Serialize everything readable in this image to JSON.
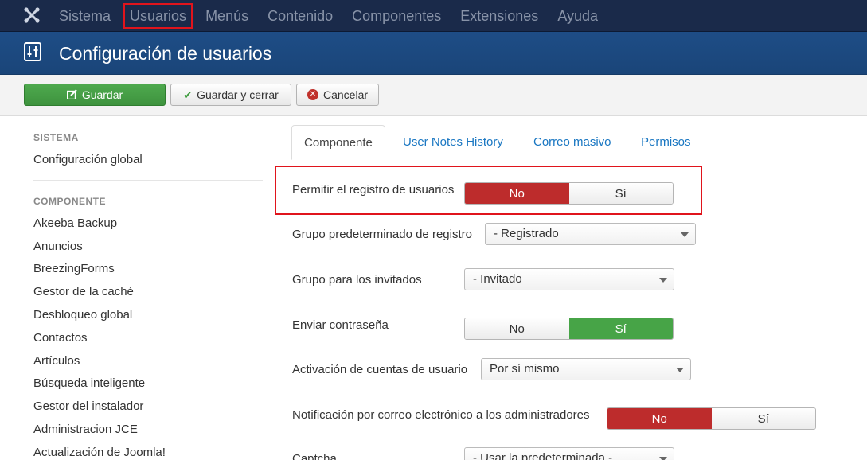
{
  "topnav": {
    "logo_icon": "joomla-logo-icon",
    "items": [
      {
        "label": "Sistema"
      },
      {
        "label": "Usuarios"
      },
      {
        "label": "Menús"
      },
      {
        "label": "Contenido"
      },
      {
        "label": "Componentes"
      },
      {
        "label": "Extensiones"
      },
      {
        "label": "Ayuda"
      }
    ],
    "active": "Usuarios"
  },
  "titlebar": {
    "title": "Configuración de usuarios",
    "icon": "equalizer-icon"
  },
  "toolbar": {
    "save_label": "Guardar",
    "save_close_label": "Guardar y cerrar",
    "cancel_label": "Cancelar",
    "save_color": "#46a546",
    "cancel_icon_color": "#c0322c"
  },
  "sidebar": {
    "system_heading": "SISTEMA",
    "global_config": "Configuración global",
    "component_heading": "COMPONENTE",
    "items": [
      {
        "label": "Akeeba Backup"
      },
      {
        "label": "Anuncios"
      },
      {
        "label": "BreezingForms"
      },
      {
        "label": "Gestor de la caché"
      },
      {
        "label": "Desbloqueo global"
      },
      {
        "label": "Contactos"
      },
      {
        "label": "Artículos"
      },
      {
        "label": "Búsqueda inteligente"
      },
      {
        "label": "Gestor del instalador"
      },
      {
        "label": "Administracion JCE"
      },
      {
        "label": "Actualización de Joomla!"
      }
    ]
  },
  "tabs": [
    {
      "label": "Componente",
      "active": true
    },
    {
      "label": "User Notes History"
    },
    {
      "label": "Correo masivo"
    },
    {
      "label": "Permisos"
    }
  ],
  "form": {
    "allow_registration": {
      "label": "Permitir el registro de usuarios",
      "no": "No",
      "yes": "Sí",
      "value": "No"
    },
    "default_group": {
      "label": "Grupo predeterminado de registro",
      "value": "- Registrado"
    },
    "guest_group": {
      "label": "Grupo para los invitados",
      "value": "- Invitado"
    },
    "send_password": {
      "label": "Enviar contraseña",
      "no": "No",
      "yes": "Sí",
      "value": "Sí"
    },
    "activation": {
      "label": "Activación de cuentas de usuario",
      "value": "Por sí mismo"
    },
    "admin_notify": {
      "label": "Notificación por correo electrónico a los administradores",
      "no": "No",
      "yes": "Sí",
      "value": "No"
    },
    "captcha": {
      "label": "Captcha",
      "value": "- Usar la predeterminada -"
    }
  },
  "colors": {
    "topnav_bg": "#1a2a4a",
    "titlebar_bg": "#1e4d86",
    "toggle_no_active": "#bd2c2c",
    "toggle_yes_active": "#47a447",
    "highlight_border": "#e0141c",
    "link": "#1a77c2"
  }
}
